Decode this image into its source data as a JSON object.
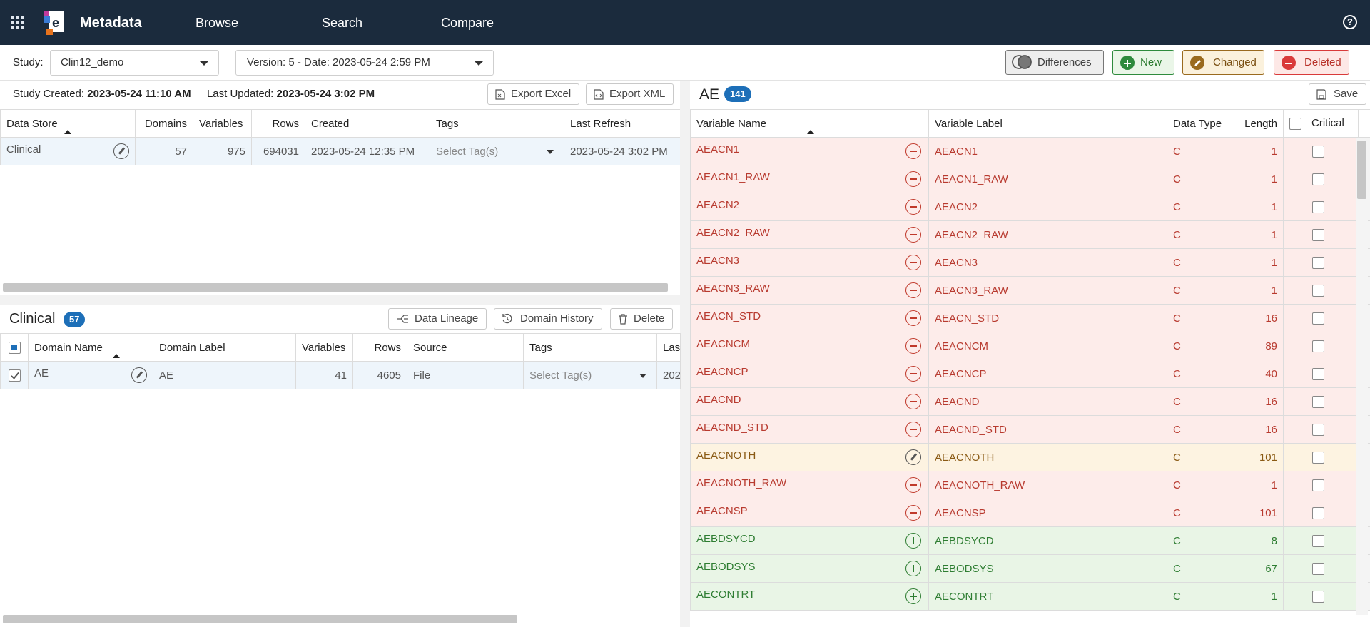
{
  "header": {
    "app_title": "Metadata",
    "nav": [
      "Browse",
      "Search",
      "Compare"
    ],
    "help_icon": "?"
  },
  "toolbar": {
    "study_label": "Study:",
    "study_value": "Clin12_demo",
    "version_value": "Version: 5 - Date: 2023-05-24 2:59 PM",
    "differences": "Differences",
    "new": "New",
    "changed": "Changed",
    "deleted": "Deleted",
    "colors": {
      "new": "#2e8b3d",
      "changed": "#9a6a1e",
      "deleted": "#d93a3a"
    }
  },
  "study_info": {
    "created_label": "Study Created:",
    "created_value": "2023-05-24 11:10 AM",
    "updated_label": "Last Updated:",
    "updated_value": "2023-05-24 3:02 PM",
    "export_excel": "Export Excel",
    "export_xml": "Export XML"
  },
  "datastore_table": {
    "columns": [
      "Data Store",
      "Domains",
      "Variables",
      "Rows",
      "Created",
      "Tags",
      "Last Refresh"
    ],
    "rows": [
      {
        "name": "Clinical",
        "domains": "57",
        "variables": "975",
        "rows": "694031",
        "created": "2023-05-24 12:35 PM",
        "tags": "Select Tag(s)",
        "last_refresh": "2023-05-24 3:02 PM"
      }
    ]
  },
  "domain_section": {
    "title": "Clinical",
    "count": "57",
    "data_lineage": "Data Lineage",
    "domain_history": "Domain History",
    "delete": "Delete",
    "columns": [
      "Domain Name",
      "Domain Label",
      "Variables",
      "Rows",
      "Source",
      "Tags",
      "Las"
    ],
    "rows": [
      {
        "name": "AE",
        "label": "AE",
        "variables": "41",
        "rows": "4605",
        "source": "File",
        "tags": "Select Tag(s)",
        "last": "202"
      }
    ]
  },
  "variables_section": {
    "title": "AE",
    "count": "141",
    "save": "Save",
    "columns": [
      "Variable Name",
      "Variable Label",
      "Data Type",
      "Length",
      "Critical"
    ],
    "rows": [
      {
        "status": "deleted",
        "name": "AEACN1",
        "label": "AEACN1",
        "type": "C",
        "length": "1"
      },
      {
        "status": "deleted",
        "name": "AEACN1_RAW",
        "label": "AEACN1_RAW",
        "type": "C",
        "length": "1"
      },
      {
        "status": "deleted",
        "name": "AEACN2",
        "label": "AEACN2",
        "type": "C",
        "length": "1"
      },
      {
        "status": "deleted",
        "name": "AEACN2_RAW",
        "label": "AEACN2_RAW",
        "type": "C",
        "length": "1"
      },
      {
        "status": "deleted",
        "name": "AEACN3",
        "label": "AEACN3",
        "type": "C",
        "length": "1"
      },
      {
        "status": "deleted",
        "name": "AEACN3_RAW",
        "label": "AEACN3_RAW",
        "type": "C",
        "length": "1"
      },
      {
        "status": "deleted",
        "name": "AEACN_STD",
        "label": "AEACN_STD",
        "type": "C",
        "length": "16"
      },
      {
        "status": "deleted",
        "name": "AEACNCM",
        "label": "AEACNCM",
        "type": "C",
        "length": "89"
      },
      {
        "status": "deleted",
        "name": "AEACNCP",
        "label": "AEACNCP",
        "type": "C",
        "length": "40"
      },
      {
        "status": "deleted",
        "name": "AEACND",
        "label": "AEACND",
        "type": "C",
        "length": "16"
      },
      {
        "status": "deleted",
        "name": "AEACND_STD",
        "label": "AEACND_STD",
        "type": "C",
        "length": "16"
      },
      {
        "status": "changed",
        "name": "AEACNOTH",
        "label": "AEACNOTH",
        "type": "C",
        "length": "101"
      },
      {
        "status": "deleted",
        "name": "AEACNOTH_RAW",
        "label": "AEACNOTH_RAW",
        "type": "C",
        "length": "1"
      },
      {
        "status": "deleted",
        "name": "AEACNSP",
        "label": "AEACNSP",
        "type": "C",
        "length": "101"
      },
      {
        "status": "new",
        "name": "AEBDSYCD",
        "label": "AEBDSYCD",
        "type": "C",
        "length": "8"
      },
      {
        "status": "new",
        "name": "AEBODSYS",
        "label": "AEBODSYS",
        "type": "C",
        "length": "67"
      },
      {
        "status": "new",
        "name": "AECONTRT",
        "label": "AECONTRT",
        "type": "C",
        "length": "1"
      }
    ]
  }
}
